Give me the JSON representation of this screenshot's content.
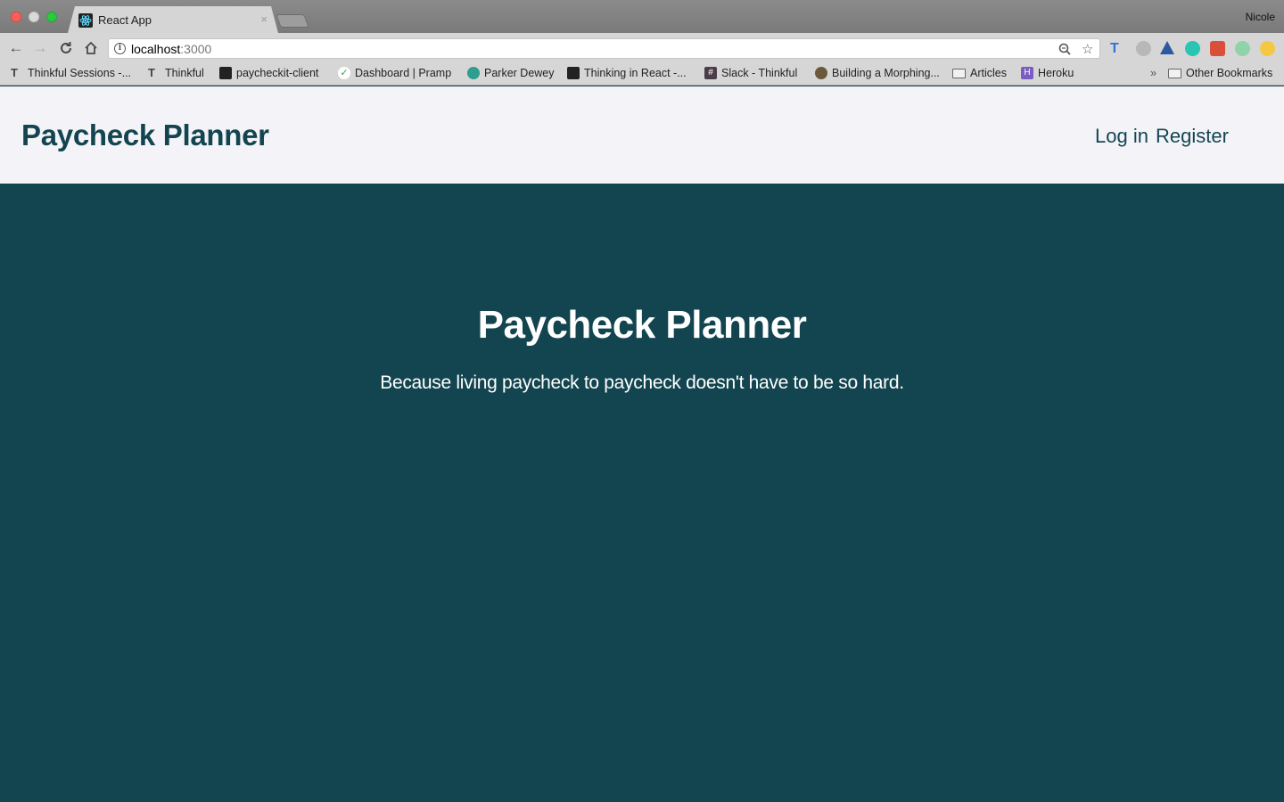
{
  "browser": {
    "tab": {
      "title": "React App",
      "close": "×"
    },
    "profile_name": "Nicole",
    "address": {
      "host": "localhost",
      "port": ":3000"
    },
    "bookmarks": [
      {
        "label": "Thinkful Sessions -...",
        "icon": "thinkful-icon"
      },
      {
        "label": "Thinkful",
        "icon": "thinkful-icon"
      },
      {
        "label": "paycheckit-client",
        "icon": "react-icon"
      },
      {
        "label": "Dashboard | Pramp",
        "icon": "check-icon"
      },
      {
        "label": "Parker Dewey",
        "icon": "parker-dewey-icon"
      },
      {
        "label": "Thinking in React -...",
        "icon": "react-icon"
      },
      {
        "label": "Slack - Thinkful",
        "icon": "slack-icon"
      },
      {
        "label": "Building a Morphing...",
        "icon": "avatar-icon"
      },
      {
        "label": "Articles",
        "icon": "folder-icon"
      },
      {
        "label": "Heroku",
        "icon": "heroku-icon"
      }
    ],
    "bookmarks_overflow": "»",
    "other_bookmarks": "Other Bookmarks"
  },
  "header": {
    "brand": "Paycheck Planner",
    "nav": {
      "login": "Log in",
      "register": "Register"
    }
  },
  "hero": {
    "title": "Paycheck Planner",
    "subtitle": "Because living paycheck to paycheck doesn't have to be so hard."
  },
  "colors": {
    "primary": "#134550",
    "header_bg": "#f4f4f8",
    "text_light": "#ffffff"
  }
}
